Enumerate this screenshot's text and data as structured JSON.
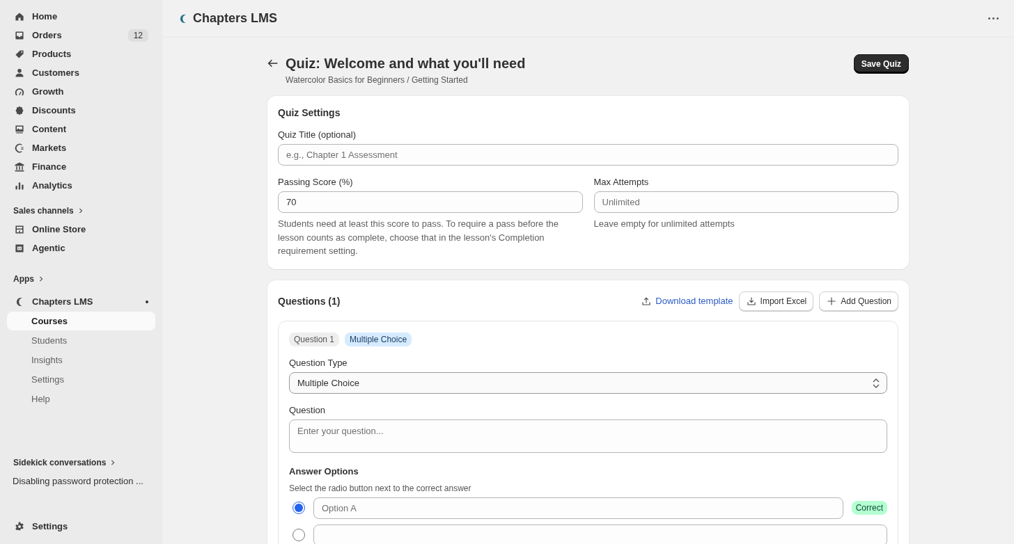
{
  "sidebar": {
    "nav": [
      {
        "label": "Home"
      },
      {
        "label": "Orders",
        "count": "12"
      },
      {
        "label": "Products"
      },
      {
        "label": "Customers"
      },
      {
        "label": "Growth"
      },
      {
        "label": "Discounts"
      },
      {
        "label": "Content"
      },
      {
        "label": "Markets"
      },
      {
        "label": "Finance"
      },
      {
        "label": "Analytics"
      }
    ],
    "sales_channels": {
      "heading": "Sales channels",
      "items": [
        {
          "label": "Online Store"
        },
        {
          "label": "Agentic"
        }
      ]
    },
    "apps": {
      "heading": "Apps",
      "app": {
        "label": "Chapters LMS",
        "children": [
          {
            "label": "Courses",
            "selected": true
          },
          {
            "label": "Students",
            "selected": false
          },
          {
            "label": "Insights",
            "selected": false
          },
          {
            "label": "Settings",
            "selected": false
          },
          {
            "label": "Help",
            "selected": false
          }
        ]
      }
    },
    "sidekick": {
      "heading": "Sidekick conversations",
      "items": [
        "Disabling password protection ..."
      ]
    },
    "footer": {
      "label": "Settings"
    }
  },
  "top_bar": {
    "title": "Chapters LMS"
  },
  "page": {
    "title": "Quiz: Welcome and what you'll need",
    "breadcrumb": "Watercolor Basics for Beginners / Getting Started",
    "save_button": "Save Quiz"
  },
  "quiz_settings": {
    "heading": "Quiz Settings",
    "title_field": {
      "label": "Quiz Title (optional)",
      "placeholder": "e.g., Chapter 1 Assessment"
    },
    "passing_score": {
      "label": "Passing Score (%)",
      "value": "70",
      "help": "Students need at least this score to pass. To require a pass before the lesson counts as complete, choose that in the lesson's Completion requirement setting."
    },
    "max_attempts": {
      "label": "Max Attempts",
      "placeholder": "Unlimited",
      "help": "Leave empty for unlimited attempts"
    }
  },
  "questions": {
    "heading": "Questions (1)",
    "actions": [
      {
        "kind": "link",
        "label": "Download template"
      },
      {
        "kind": "import",
        "label": "Import Excel"
      },
      {
        "kind": "add",
        "label": "Add Question"
      }
    ],
    "items": [
      {
        "number_badge": "Question 1",
        "type_badge": "Multiple Choice",
        "type_label": "Question Type",
        "type_value": "Multiple Choice",
        "question_label": "Question",
        "question_placeholder": "Enter your question...",
        "answers_heading": "Answer Options",
        "answers_help": "Select the radio button next to the correct answer",
        "options": [
          {
            "placeholder": "Option A",
            "selected": true,
            "badge": "Correct"
          },
          {
            "selected": false
          }
        ]
      }
    ]
  }
}
